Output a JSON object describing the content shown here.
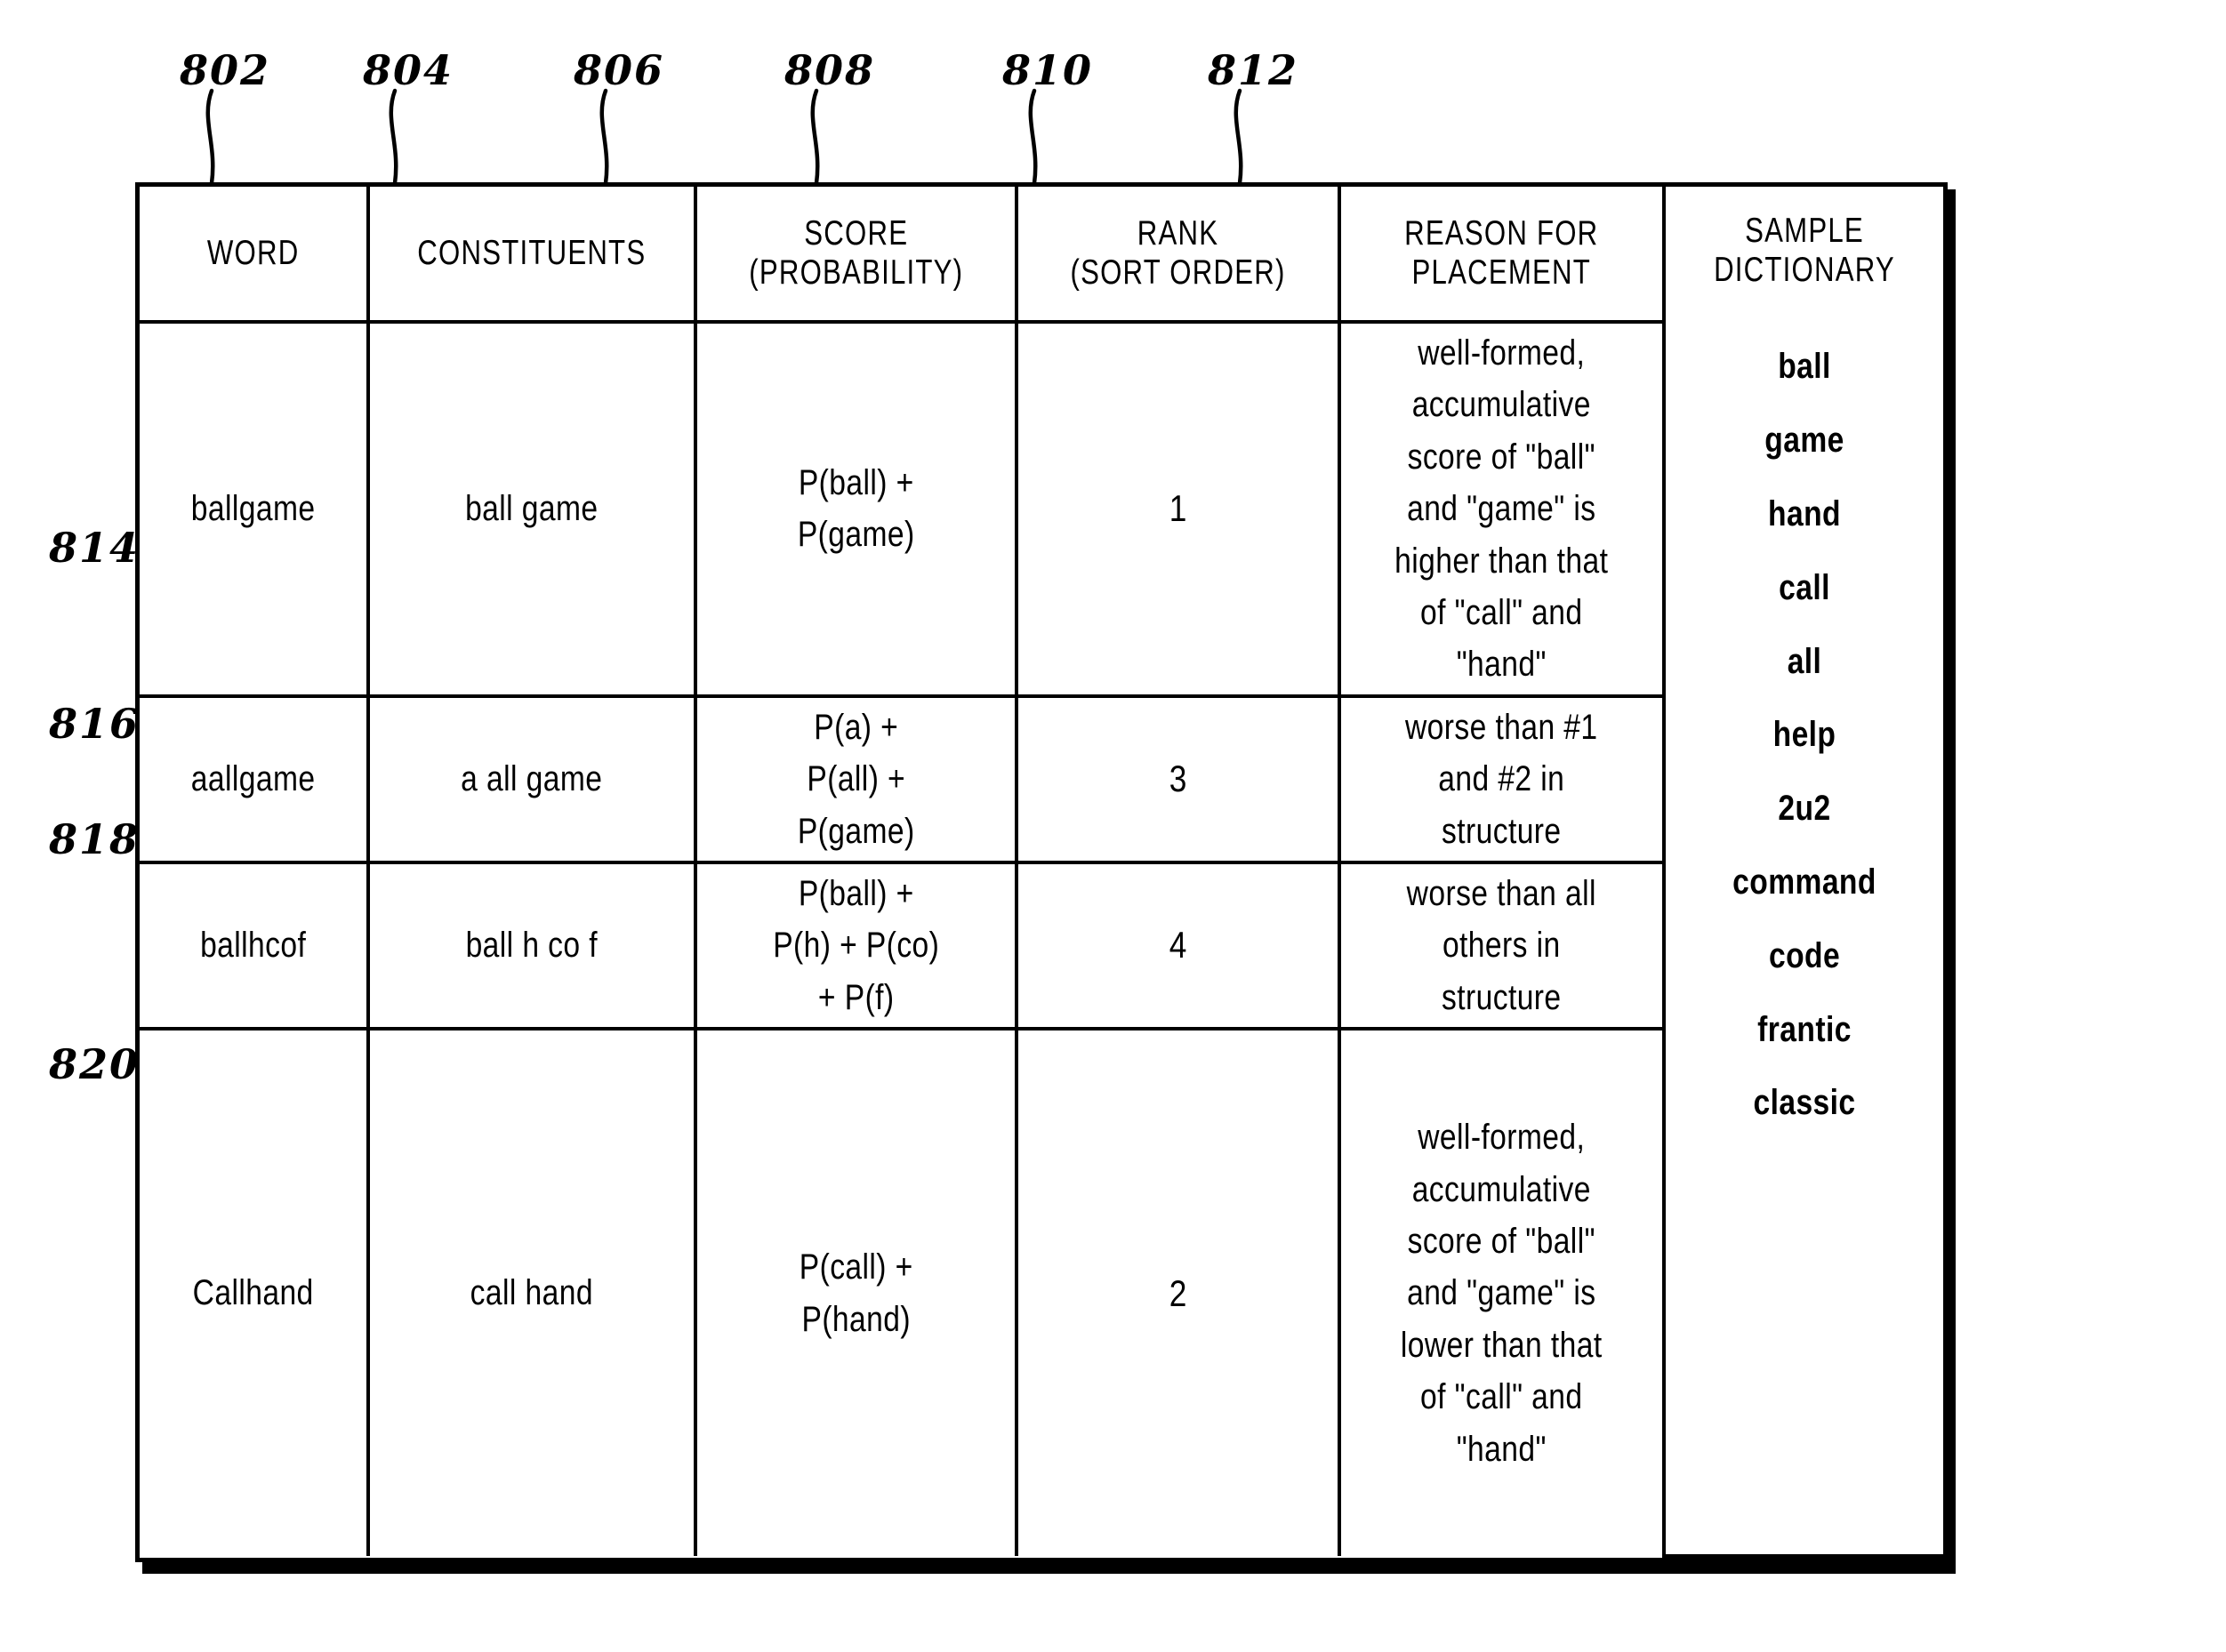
{
  "figure": {
    "column_refs": [
      {
        "id": "802",
        "target": "WORD"
      },
      {
        "id": "804",
        "target": "CONSTITUENTS"
      },
      {
        "id": "806",
        "target": "SCORE (PROBABILITY)"
      },
      {
        "id": "808",
        "target": "RANK (SORT ORDER)"
      },
      {
        "id": "810",
        "target": "REASON FOR PLACEMENT"
      },
      {
        "id": "812",
        "target": "SAMPLE DICTIONARY"
      }
    ],
    "row_refs": [
      {
        "id": "814",
        "target": "ballgame"
      },
      {
        "id": "816",
        "target": "aallgame"
      },
      {
        "id": "818",
        "target": "ballhcof"
      },
      {
        "id": "820",
        "target": "Callhand"
      }
    ]
  },
  "table": {
    "headers": [
      {
        "line1": "WORD",
        "line2": ""
      },
      {
        "line1": "CONSTITUENTS",
        "line2": ""
      },
      {
        "line1": "SCORE",
        "line2": "(PROBABILITY)"
      },
      {
        "line1": "RANK",
        "line2": "(SORT ORDER)"
      },
      {
        "line1": "REASON FOR",
        "line2": "PLACEMENT"
      },
      {
        "line1": "SAMPLE",
        "line2": "DICTIONARY"
      }
    ],
    "rows": [
      {
        "word": "ballgame",
        "constituents": "ball  game",
        "score_lines": [
          "P(ball) +",
          "P(game)"
        ],
        "rank": "1",
        "reason_lines": [
          "well-formed,",
          "accumulative",
          "score of \"ball\"",
          "and \"game\" is",
          "higher than that",
          "of \"call\" and",
          "\"hand\""
        ]
      },
      {
        "word": "aallgame",
        "constituents": "a  all  game",
        "score_lines": [
          "P(a) +",
          "P(all) +",
          "P(game)"
        ],
        "rank": "3",
        "reason_lines": [
          "worse than #1",
          "and #2 in",
          "structure"
        ]
      },
      {
        "word": "ballhcof",
        "constituents": "ball  h  co  f",
        "score_lines": [
          "P(ball) +",
          "P(h) + P(co)",
          "+ P(f)"
        ],
        "rank": "4",
        "reason_lines": [
          "worse than all",
          "others in",
          "structure"
        ]
      },
      {
        "word": "Callhand",
        "constituents": "call  hand",
        "score_lines": [
          "P(call) +",
          "P(hand)"
        ],
        "rank": "2",
        "reason_lines": [
          "well-formed,",
          "accumulative",
          "score of \"ball\"",
          "and \"game\" is",
          "lower than that",
          "of \"call\" and",
          "\"hand\""
        ]
      }
    ],
    "sample_dictionary": [
      "ball",
      "game",
      "hand",
      "call",
      "all",
      "help",
      "2u2",
      "command",
      "code",
      "frantic",
      "classic"
    ]
  },
  "colors": {
    "ink": "#000000",
    "paper": "#ffffff"
  }
}
